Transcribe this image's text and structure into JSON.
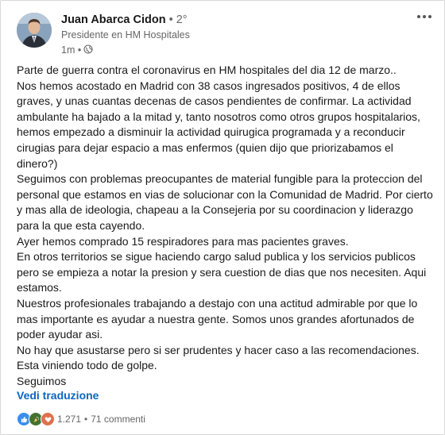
{
  "post": {
    "author_name": "Juan Abarca Cidon",
    "degree": " • 2°",
    "headline": "Presidente en HM Hospitales",
    "time": "1m • ",
    "body_lines": [
      "Parte de guerra contra el coronavirus en HM hospitales del dia 12 de marzo..",
      "Nos hemos acostado en Madrid con 38 casos ingresados positivos, 4 de ellos graves, y unas cuantas decenas de casos pendientes de confirmar. La actividad ambulante ha bajado a la mitad y, tanto nosotros como otros grupos hospitalarios, hemos empezado a disminuir la actividad quirugica programada y a reconducir cirugias para dejar espacio a mas enfermos (quien dijo que priorizabamos el dinero?)",
      "Seguimos con problemas preocupantes de material fungible para la proteccion del personal que estamos en vias de solucionar con la Comunidad de Madrid. Por cierto y mas alla de ideologia, chapeau a la Consejeria por su coordinacion y liderazgo para la que esta cayendo.",
      "Ayer hemos comprado 15 respiradores para mas pacientes graves.",
      "En otros territorios se sigue haciendo cargo salud publica y los servicios publicos pero se empieza a notar la presion y sera cuestion de dias que nos necesiten. Aqui estamos.",
      "Nuestros profesionales trabajando a destajo con una actitud admirable por que lo mas importante es ayudar a nuestra gente. Somos unos grandes afortunados de poder ayudar asi.",
      "No hay que asustarse pero si ser prudentes y hacer caso a las recomendaciones. Esta viniendo todo de golpe.",
      "Seguimos"
    ],
    "translate_label": "Vedi traduzione",
    "reaction_count": "1.271",
    "comments": "71 commenti",
    "separator": "•"
  },
  "icons": {
    "more": "more-horizontal-icon",
    "globe": "globe-icon",
    "reactions": [
      "like-icon",
      "celebrate-icon",
      "love-icon"
    ]
  },
  "colors": {
    "link": "#0a66c2",
    "like": "#378fe9",
    "celebrate": "#44712e",
    "love": "#df704d"
  }
}
